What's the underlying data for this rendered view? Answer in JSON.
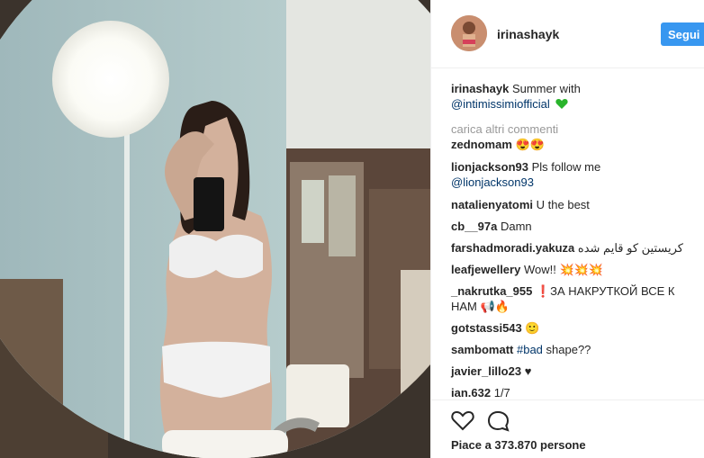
{
  "post": {
    "username": "irinashayk",
    "follow_label": "Segui",
    "caption_user": "irinashayk",
    "caption_text": "Summer with",
    "caption_mention": "@intimissimiofficial",
    "load_more": "carica altri commenti",
    "likes": "Piace a 373.870 persone"
  },
  "comments": [
    {
      "user": "zednomam",
      "text": "",
      "emoji": "😍😍"
    },
    {
      "user": "lionjackson93",
      "text": "Pls follow me",
      "line2": "@lionjackson93"
    },
    {
      "user": "natalienyatomi",
      "text": "U the best"
    },
    {
      "user": "cb__97a",
      "text": "Damn"
    },
    {
      "user": "farshadmoradi.yakuza",
      "text": "کریستین کو قایم شده"
    },
    {
      "user": "leafjewellery",
      "text": "Wow!!",
      "emoji": "💥💥💥"
    },
    {
      "user": "_nakrutka_955",
      "text": "❗ЗА НАКРУТКОЙ ВСЕ К",
      "line2": "НАМ 📢🔥"
    },
    {
      "user": "gotstassi543",
      "text": "",
      "emoji": "🙂"
    },
    {
      "user": "sambomatt",
      "text": "shape??",
      "hashtag": "#bad"
    },
    {
      "user": "javier_lillo23",
      "text": "",
      "emoji": "♥"
    },
    {
      "user": "ian.632",
      "text": "1/7"
    }
  ],
  "icons": {
    "like": "heart-outline-icon",
    "comment": "comment-bubble-icon",
    "caption_emoji": "green-heart-icon"
  },
  "colors": {
    "link": "#003569",
    "follow_button": "#3897f0",
    "muted": "#999999"
  }
}
